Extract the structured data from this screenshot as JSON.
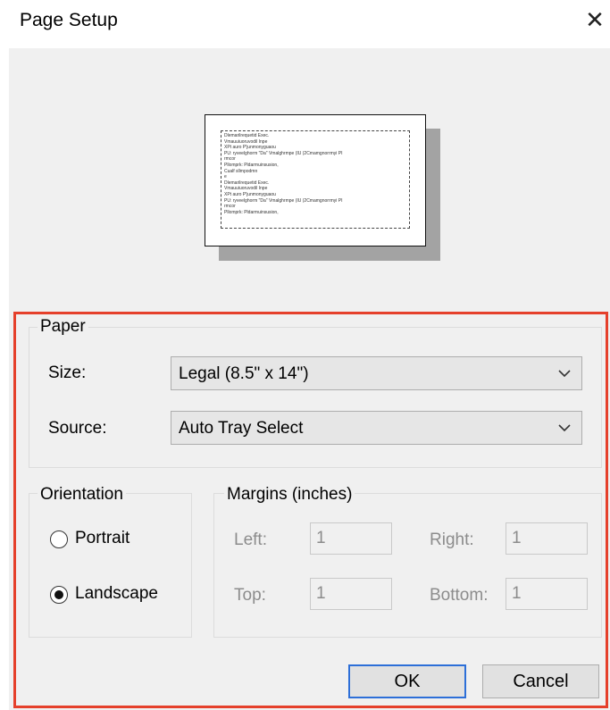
{
  "window": {
    "title": "Page Setup"
  },
  "preview": {
    "text_lines": [
      "Dlemarilrequetid Exec.",
      "Vmauuiuoruvodil Inpe",
      "XPt auro P'junmonyguaou",
      "PU: ryveelghorm \"Da\" Vmalghrmpe (IU (2Cmamgnorrmyi PI",
      "rmcor",
      "Pllomprk: Pldarmuinsusion,",
      "Cualf sllmpodmn",
      "e",
      "Dlemarilrequetid Exec.",
      "Vmauuiuoruvodil Inpe",
      "XPt auro P'junmonyguaou",
      "PU: ryveelghorm \"Da\" Vmalghrmpe (IU (2Cmamgnorrmyi PI",
      "rmcor",
      "Pllomprk: Pldarmuinsusion,"
    ]
  },
  "paper": {
    "legend": "Paper",
    "size_label": "Size:",
    "size_value": "Legal (8.5\" x 14\")",
    "source_label": "Source:",
    "source_value": "Auto Tray Select"
  },
  "orientation": {
    "legend": "Orientation",
    "portrait_label": "Portrait",
    "landscape_label": "Landscape",
    "selected": "Landscape"
  },
  "margins": {
    "legend": "Margins (inches)",
    "left_label": "Left:",
    "left_value": "1",
    "right_label": "Right:",
    "right_value": "1",
    "top_label": "Top:",
    "top_value": "1",
    "bottom_label": "Bottom:",
    "bottom_value": "1"
  },
  "buttons": {
    "ok": "OK",
    "cancel": "Cancel"
  },
  "colors": {
    "highlight": "#e5402b",
    "dialog_bg": "#f0f0f0",
    "focus_border": "#2d6fd8"
  }
}
